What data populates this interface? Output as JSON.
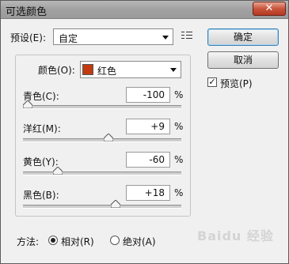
{
  "window": {
    "title": "可选颜色",
    "close_label": "✕"
  },
  "preset": {
    "label": "预设(E):",
    "value": "自定"
  },
  "buttons": {
    "ok": "确定",
    "cancel": "取消"
  },
  "preview": {
    "label": "预览(P)",
    "checked": true
  },
  "colors": {
    "label": "颜色(O):",
    "value": "红色",
    "swatch": "#c23a10"
  },
  "sliders": [
    {
      "label": "青色(C):",
      "value": "-100",
      "unit": "%",
      "level": 0.0
    },
    {
      "label": "洋红(M):",
      "value": "+9",
      "unit": "%",
      "level": 0.545
    },
    {
      "label": "黄色(Y):",
      "value": "-60",
      "unit": "%",
      "level": 0.2
    },
    {
      "label": "黑色(B):",
      "value": "+18",
      "unit": "%",
      "level": 0.59
    }
  ],
  "method": {
    "label": "方法:",
    "options": [
      {
        "label": "相对(R)",
        "selected": true
      },
      {
        "label": "绝对(A)",
        "selected": false
      }
    ]
  },
  "watermark": "Baidu 经验"
}
